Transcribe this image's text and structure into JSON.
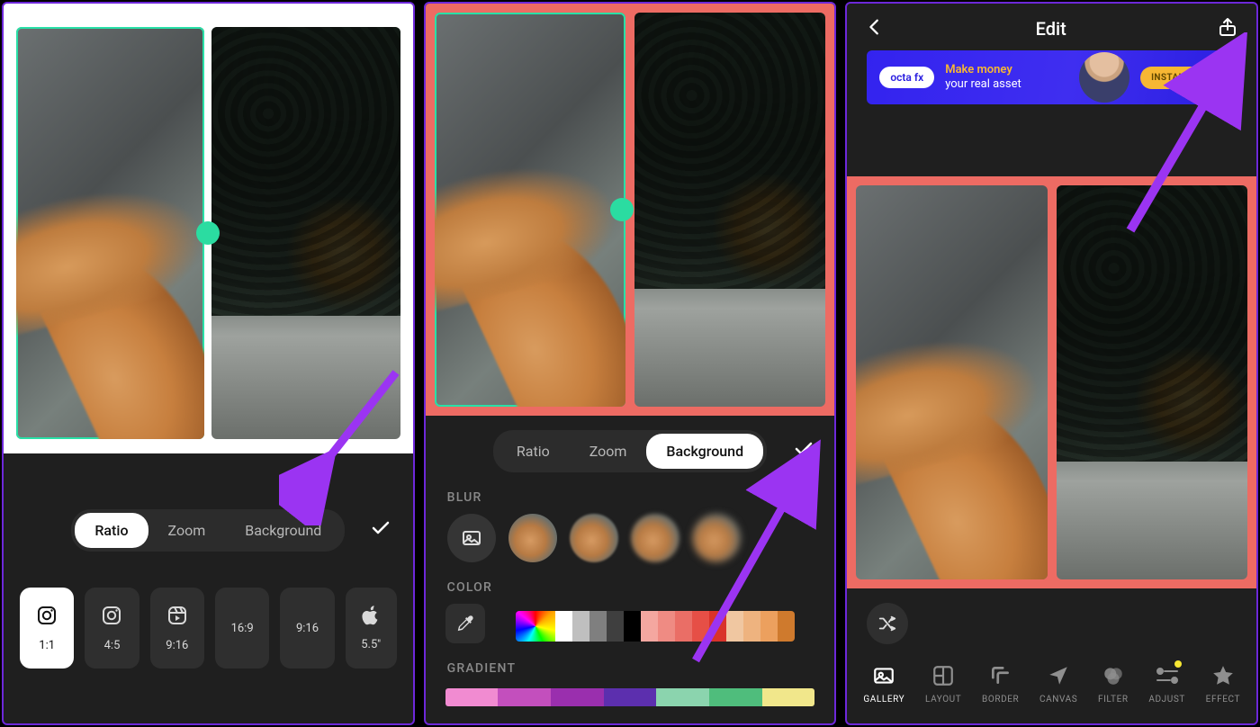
{
  "screen1": {
    "tabs": {
      "ratio": "Ratio",
      "zoom": "Zoom",
      "background": "Background"
    },
    "active_tab": "ratio",
    "ratios": [
      {
        "label": "1:1",
        "icon": "⎚"
      },
      {
        "label": "4:5",
        "icon": "⎚"
      },
      {
        "label": "9:16",
        "icon": "▦"
      },
      {
        "label": "16:9",
        "icon": ""
      },
      {
        "label": "9:16",
        "icon": ""
      },
      {
        "label": "5.5''",
        "icon": ""
      }
    ]
  },
  "screen2": {
    "tabs": {
      "ratio": "Ratio",
      "zoom": "Zoom",
      "background": "Background"
    },
    "active_tab": "background",
    "sections": {
      "blur": "BLUR",
      "color": "COLOR",
      "gradient": "GRADIENT"
    },
    "color_swatches": [
      "#ffffff",
      "#bfbfbf",
      "#7f7f7f",
      "#3f3f3f",
      "#000000",
      "#f4a7a0",
      "#ef8b83",
      "#ea6e66",
      "#e64f46",
      "#d9332a",
      "#f0c7a1",
      "#eeb37f",
      "#eca05e",
      "#cf7a2d",
      "#b3571c"
    ],
    "gradients": [
      "#f18bd1",
      "#c34fbd",
      "#9a2fae",
      "#5c2fae",
      "#8bd4ae",
      "#4fbd7c",
      "#f1e78b"
    ]
  },
  "screen3": {
    "title": "Edit",
    "ad": {
      "brand": "octa fx",
      "line1": "Make money",
      "line2": "your real asset",
      "cta": "INSTALL NOW"
    },
    "tools": [
      {
        "id": "gallery",
        "label": "GALLERY"
      },
      {
        "id": "layout",
        "label": "LAYOUT"
      },
      {
        "id": "border",
        "label": "BORDER"
      },
      {
        "id": "canvas",
        "label": "CANVAS"
      },
      {
        "id": "filter",
        "label": "FILTER"
      },
      {
        "id": "adjust",
        "label": "ADJUST"
      },
      {
        "id": "effect",
        "label": "EFFECT"
      }
    ]
  }
}
